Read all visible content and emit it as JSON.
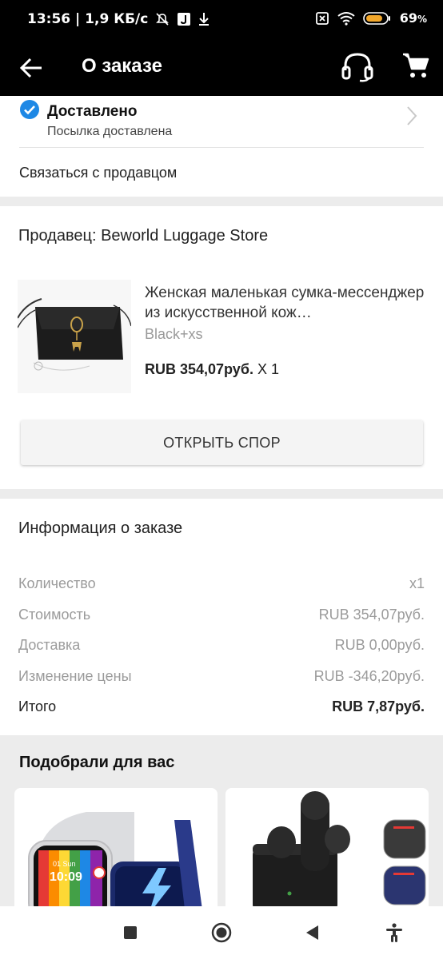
{
  "status_bar": {
    "time_speed": "13:56 | 1,9 КБ/с",
    "battery": "69"
  },
  "header": {
    "title": "О заказе"
  },
  "order_status": {
    "title": "Доставлено",
    "subtitle": "Посылка доставлена",
    "contact_seller": "Связаться с продавцом"
  },
  "seller": {
    "label": "Продавец: Beworld Luggage Store"
  },
  "product": {
    "title": "Женская маленькая сумка-мессенджер из искусственной кож…",
    "variant": "Black+xs",
    "price": "RUB 354,07руб.",
    "quantity": "X 1"
  },
  "dispute_button": "ОТКРЫТЬ СПОР",
  "order_info": {
    "title": "Информация о заказе",
    "rows": [
      {
        "label": "Количество",
        "value": "x1"
      },
      {
        "label": "Стоимость",
        "value": "RUB 354,07руб."
      },
      {
        "label": "Доставка",
        "value": "RUB 0,00руб."
      },
      {
        "label": "Изменение цены",
        "value": "RUB -346,20руб."
      },
      {
        "label": "Итого",
        "value": "RUB 7,87руб."
      }
    ]
  },
  "recommendations": {
    "title": "Подобрали для вас",
    "watch_time": "01 Sun\n10:09"
  },
  "colors": {
    "accent_blue": "#1e88e5",
    "header_bg": "#000000"
  },
  "icons": [
    "back-arrow-icon",
    "support-headset-icon",
    "cart-icon",
    "check-circle-icon",
    "chevron-right-icon",
    "nav-recents-icon",
    "nav-home-icon",
    "nav-back-icon",
    "accessibility-icon"
  ]
}
